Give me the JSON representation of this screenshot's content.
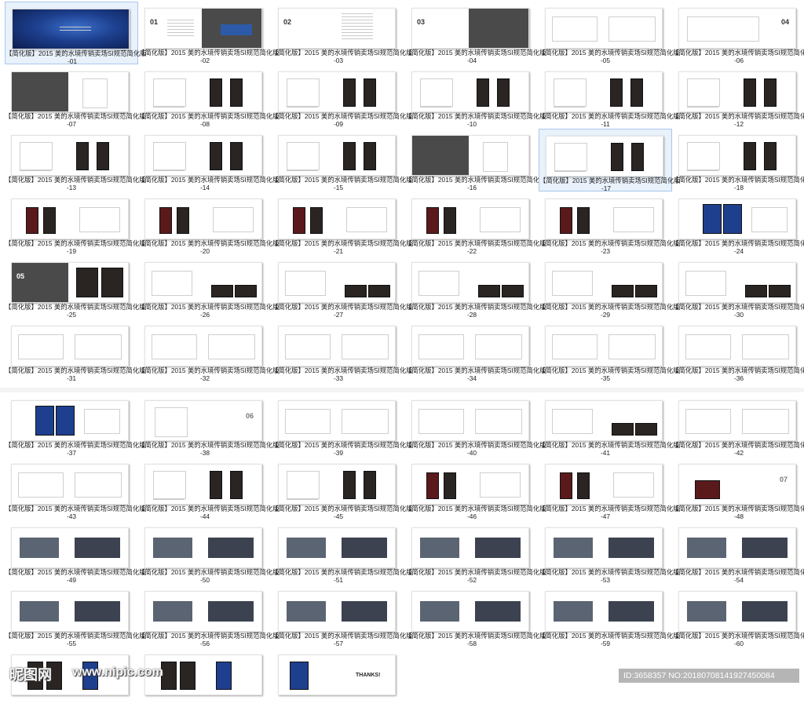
{
  "caption_prefix": "【简化版】2015 美的水境传销卖场SI规范简化版",
  "thumbnails_panel1": [
    {
      "num": "-01",
      "kind": "cover"
    },
    {
      "num": "-02",
      "kind": "contents01"
    },
    {
      "num": "-03",
      "kind": "contents02"
    },
    {
      "num": "-04",
      "kind": "contents03"
    },
    {
      "num": "-05",
      "kind": "drawing"
    },
    {
      "num": "-06",
      "kind": "section04"
    },
    {
      "num": "-07",
      "kind": "darktitle"
    },
    {
      "num": "-08",
      "kind": "cabinet"
    },
    {
      "num": "-09",
      "kind": "cabinet"
    },
    {
      "num": "-10",
      "kind": "cabinet"
    },
    {
      "num": "-11",
      "kind": "cabinet"
    },
    {
      "num": "-12",
      "kind": "cabinet"
    },
    {
      "num": "-13",
      "kind": "cabinet"
    },
    {
      "num": "-14",
      "kind": "cabinet"
    },
    {
      "num": "-15",
      "kind": "cabinet"
    },
    {
      "num": "-16",
      "kind": "darktitle"
    },
    {
      "num": "-17",
      "kind": "cabinet"
    },
    {
      "num": "-18",
      "kind": "cabinet"
    },
    {
      "num": "-19",
      "kind": "cabinet-red"
    },
    {
      "num": "-20",
      "kind": "cabinet-red"
    },
    {
      "num": "-21",
      "kind": "cabinet-red"
    },
    {
      "num": "-22",
      "kind": "cabinet-red"
    },
    {
      "num": "-23",
      "kind": "cabinet-red"
    },
    {
      "num": "-24",
      "kind": "cabinet-blue"
    },
    {
      "num": "-25",
      "kind": "section05"
    },
    {
      "num": "-26",
      "kind": "counter"
    },
    {
      "num": "-27",
      "kind": "counter"
    },
    {
      "num": "-28",
      "kind": "counter"
    },
    {
      "num": "-29",
      "kind": "counter"
    },
    {
      "num": "-30",
      "kind": "counter"
    },
    {
      "num": "-31",
      "kind": "drawing"
    },
    {
      "num": "-32",
      "kind": "drawing"
    },
    {
      "num": "-33",
      "kind": "drawing"
    },
    {
      "num": "-34",
      "kind": "drawing"
    },
    {
      "num": "-35",
      "kind": "drawing"
    },
    {
      "num": "-36",
      "kind": "drawing"
    }
  ],
  "thumbnails_panel2": [
    {
      "num": "-37",
      "kind": "cabinet-blue"
    },
    {
      "num": "-38",
      "kind": "section06"
    },
    {
      "num": "-39",
      "kind": "drawing"
    },
    {
      "num": "-40",
      "kind": "drawing"
    },
    {
      "num": "-41",
      "kind": "counter"
    },
    {
      "num": "-42",
      "kind": "drawing"
    },
    {
      "num": "-43",
      "kind": "drawing"
    },
    {
      "num": "-44",
      "kind": "cabinet"
    },
    {
      "num": "-45",
      "kind": "cabinet"
    },
    {
      "num": "-46",
      "kind": "cabinet-red"
    },
    {
      "num": "-47",
      "kind": "cabinet-red"
    },
    {
      "num": "-48",
      "kind": "section07"
    },
    {
      "num": "-49",
      "kind": "store"
    },
    {
      "num": "-50",
      "kind": "store"
    },
    {
      "num": "-51",
      "kind": "store"
    },
    {
      "num": "-52",
      "kind": "store"
    },
    {
      "num": "-53",
      "kind": "store"
    },
    {
      "num": "-54",
      "kind": "store"
    },
    {
      "num": "-55",
      "kind": "store"
    },
    {
      "num": "-56",
      "kind": "store"
    },
    {
      "num": "-57",
      "kind": "store"
    },
    {
      "num": "-58",
      "kind": "store"
    },
    {
      "num": "-59",
      "kind": "store"
    },
    {
      "num": "-60",
      "kind": "store"
    },
    {
      "num": "",
      "kind": "products"
    },
    {
      "num": "",
      "kind": "products"
    },
    {
      "num": "",
      "kind": "thanks"
    }
  ],
  "selected": [
    "-01",
    "-17"
  ],
  "section_labels": {
    "s01": "01",
    "s02": "02",
    "s03": "03",
    "s04": "04",
    "s05": "05",
    "s06": "06",
    "s07": "07",
    "thanks": "THANKS!"
  },
  "watermark": {
    "logo": "昵图网",
    "url": "www.nipic.com",
    "id": "ID:3658357 NO:20180708141927450084"
  },
  "colors": {
    "selected_bg": "#e9f1fb",
    "selected_border": "#a9c8ec",
    "dark_panel": "#4b4a4a"
  }
}
